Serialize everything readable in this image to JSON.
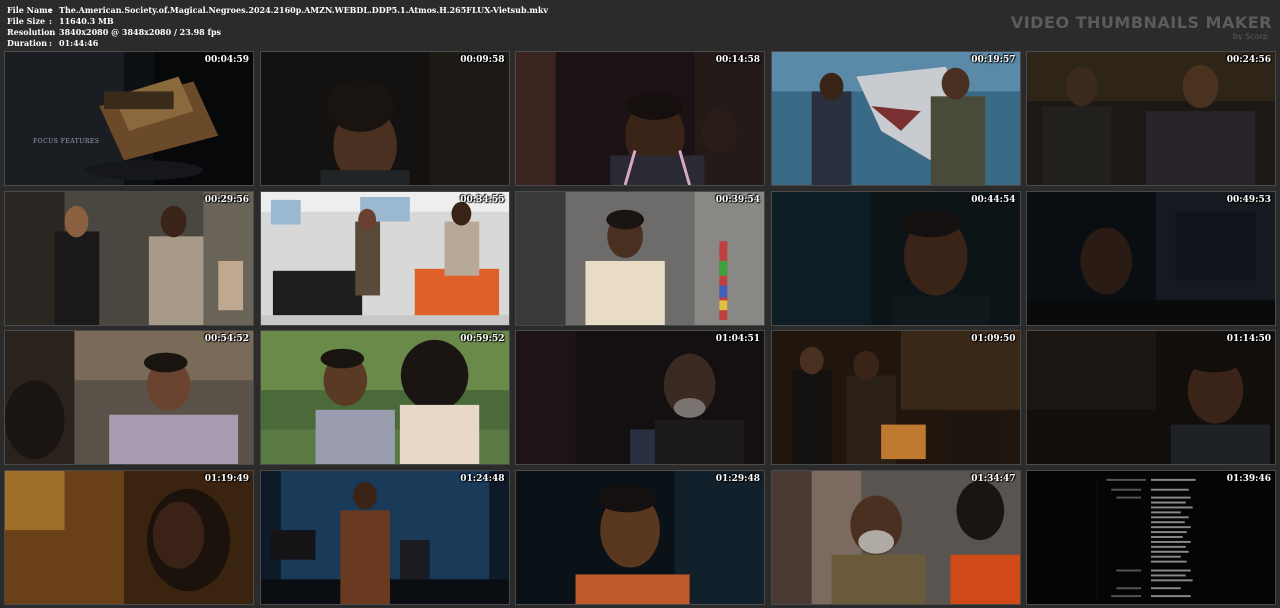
{
  "file_info": {
    "rows": [
      {
        "label": "File Name",
        "value": "The.American.Society.of.Magical.Negroes.2024.2160p.AMZN.WEBDL.DDP5.1.Atmos.H.265FLUX-Vietsub.mkv"
      },
      {
        "label": "File Size",
        "value": "11640.3 MB"
      },
      {
        "label": "Resolution",
        "value": "3840x2080 @ 3848x2080 / 23.98 fps"
      },
      {
        "label": "Duration",
        "value": "01:44:46"
      }
    ],
    "separator": ":"
  },
  "brand": {
    "title": "VIDEO THUMBNAILS MAKER",
    "subtitle": "by Scorp"
  },
  "thumbnails": [
    {
      "time": "00:04:59",
      "overlay_text": "FOCUS FEATURES"
    },
    {
      "time": "00:09:58"
    },
    {
      "time": "00:14:58"
    },
    {
      "time": "00:19:57"
    },
    {
      "time": "00:24:56"
    },
    {
      "time": "00:29:56"
    },
    {
      "time": "00:34:55"
    },
    {
      "time": "00:39:54"
    },
    {
      "time": "00:44:54"
    },
    {
      "time": "00:49:53"
    },
    {
      "time": "00:54:52"
    },
    {
      "time": "00:59:52"
    },
    {
      "time": "01:04:51"
    },
    {
      "time": "01:09:50"
    },
    {
      "time": "01:14:50"
    },
    {
      "time": "01:19:49"
    },
    {
      "time": "01:24:48"
    },
    {
      "time": "01:29:48"
    },
    {
      "time": "01:34:47"
    },
    {
      "time": "01:39:46"
    }
  ],
  "colors": {
    "background": "#2b2b2b",
    "text": "#ffffff",
    "brand": "#5c5c5c"
  }
}
